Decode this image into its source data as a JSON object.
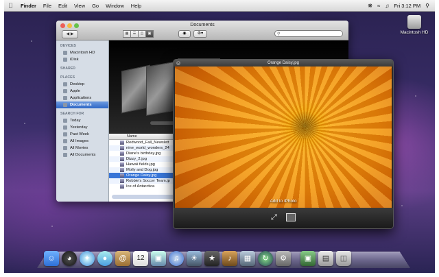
{
  "menubar": {
    "apple": "",
    "items": [
      "Finder",
      "File",
      "Edit",
      "View",
      "Go",
      "Window",
      "Help"
    ],
    "clock": "Fri 3:12 PM"
  },
  "desktop": {
    "disk_label": "Macintosh HD"
  },
  "finder": {
    "title": "Documents",
    "sidebar": {
      "devices_header": "DEVICES",
      "devices": [
        "Macintosh HD",
        "iDisk"
      ],
      "shared_header": "SHARED",
      "places_header": "PLACES",
      "places": [
        "Desktop",
        "Apple",
        "Applications",
        "Documents"
      ],
      "search_header": "SEARCH FOR",
      "search": [
        "Today",
        "Yesterday",
        "Past Week",
        "All Images",
        "All Movies",
        "All Documents"
      ]
    },
    "list_header": "Name",
    "files": [
      "Redwood_Fall_Newslett",
      "nine_world_wonders_24",
      "Diane's birthday.jpg",
      "Dizzy_2.jpg",
      "Hawaii fields.jpg",
      "Molly and Dog.jpg",
      "Orange Daisy.jpg",
      "Robbie's Soccer Team.jp",
      "Ice of Antarctica"
    ],
    "selected_file": "Orange Daisy.jpg"
  },
  "quicklook": {
    "title": "Orange Daisy.jpg",
    "add_label": "Add to iPhoto"
  },
  "colors": {
    "selection": "#3875d7",
    "sidebar_bg": "#d6dde6",
    "close": "#ec5f57",
    "minimize": "#f4bc3f",
    "zoom": "#67c24a"
  },
  "dock": {
    "icons": [
      "finder-icon",
      "dashboard-icon",
      "safari-icon",
      "ichat-icon",
      "address-book-icon",
      "ical-icon",
      "preview-icon",
      "itunes-icon",
      "iphoto-icon",
      "imovie-icon",
      "garageband-icon",
      "spaces-icon",
      "time-machine-icon",
      "system-preferences-icon",
      "photos-stack-icon",
      "downloads-stack-icon",
      "trash-icon"
    ]
  }
}
